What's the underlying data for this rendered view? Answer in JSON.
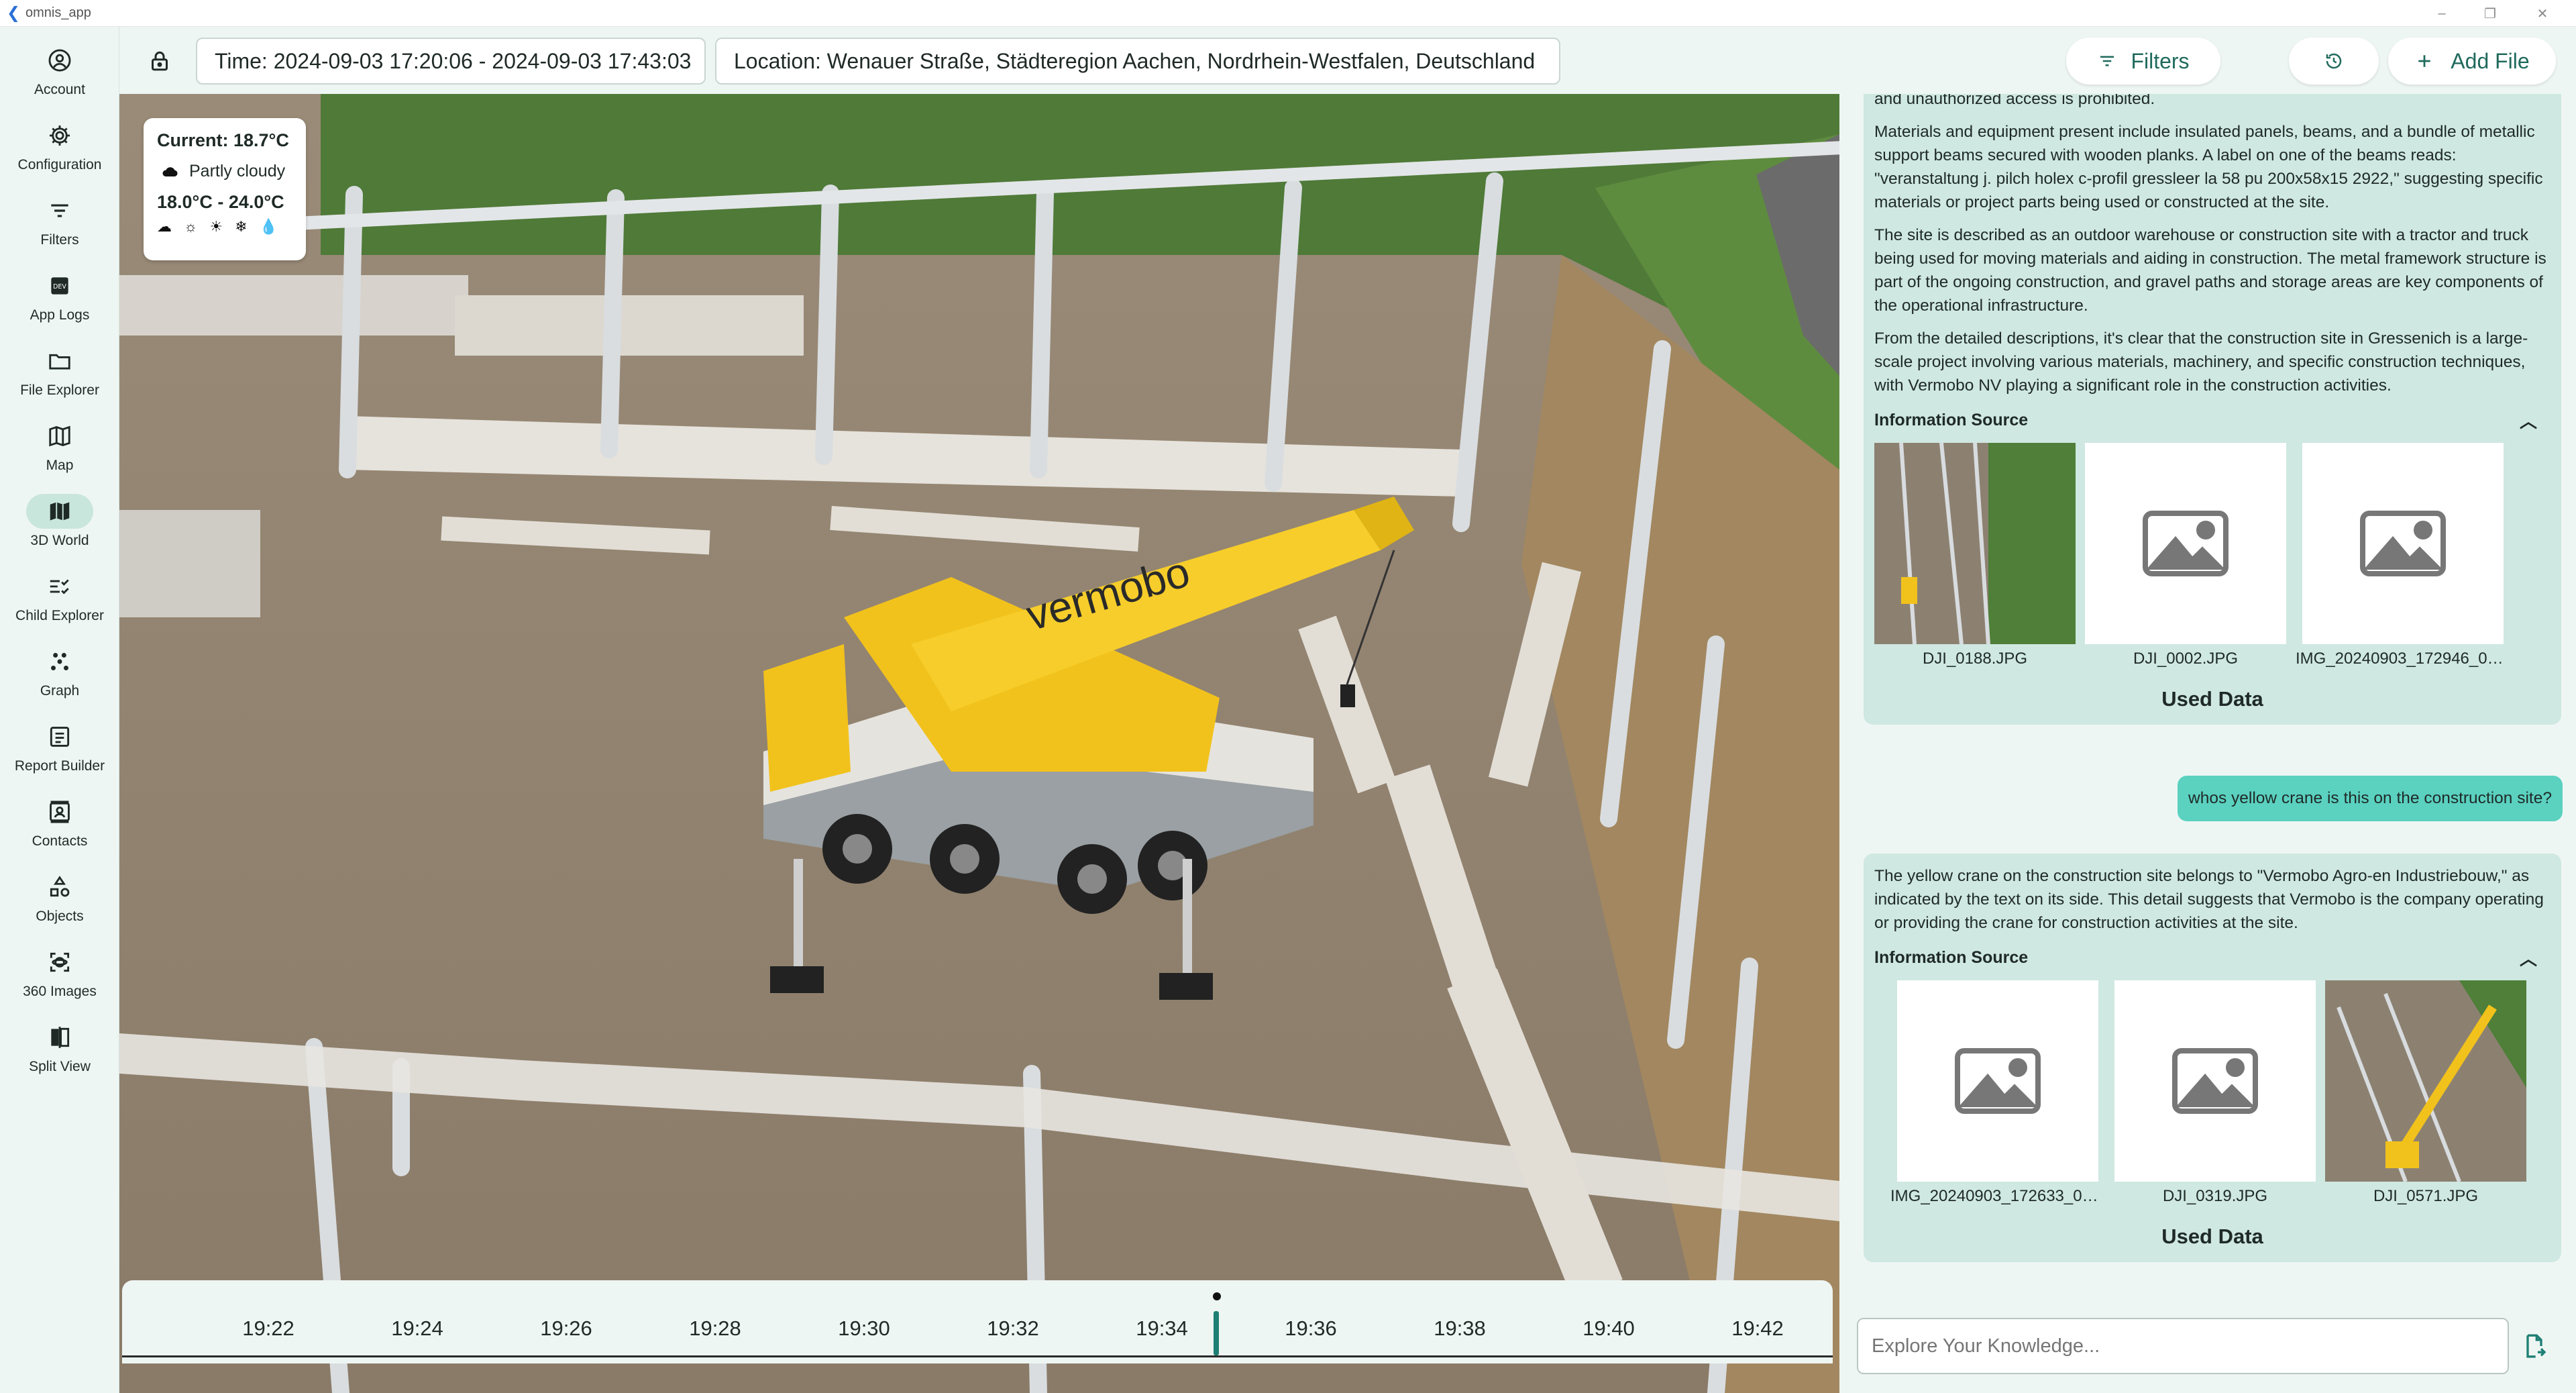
{
  "window": {
    "app_name": "omnis_app"
  },
  "sidebar": {
    "items": [
      {
        "label": "Account",
        "icon": "account-circle-icon"
      },
      {
        "label": "Configuration",
        "icon": "gear-icon"
      },
      {
        "label": "Filters",
        "icon": "filter-icon"
      },
      {
        "label": "App Logs",
        "icon": "dev-logs-icon"
      },
      {
        "label": "File Explorer",
        "icon": "folder-icon"
      },
      {
        "label": "Map",
        "icon": "map-icon"
      },
      {
        "label": "3D World",
        "icon": "3d-map-icon",
        "active": true
      },
      {
        "label": "Child Explorer",
        "icon": "checklist-icon"
      },
      {
        "label": "Graph",
        "icon": "graph-icon"
      },
      {
        "label": "Report Builder",
        "icon": "report-icon"
      },
      {
        "label": "Contacts",
        "icon": "contacts-icon"
      },
      {
        "label": "Objects",
        "icon": "objects-icon"
      },
      {
        "label": "360 Images",
        "icon": "360-icon"
      },
      {
        "label": "Split View",
        "icon": "split-view-icon"
      }
    ]
  },
  "toolbar": {
    "time_label": "Time: 2024-09-03 17:20:06 - 2024-09-03 17:43:03",
    "location_label": "Location: Wenauer Straße, Städteregion Aachen, Nordrhein-Westfalen, Deutschland",
    "filters_label": "Filters",
    "add_file_label": "Add File"
  },
  "weather": {
    "current": "Current: 18.7°C",
    "condition": "Partly cloudy",
    "range": "18.0°C - 24.0°C",
    "forecast_icons": "☁ ☼ ☀ ❄ 💧"
  },
  "timeline": {
    "ticks": [
      "19:22",
      "19:24",
      "19:26",
      "19:28",
      "19:30",
      "19:32",
      "19:34",
      "19:36",
      "19:38",
      "19:40",
      "19:42"
    ]
  },
  "chat": {
    "messages": [
      {
        "role": "assistant",
        "paragraphs": [
          "and unauthorized access is prohibited.",
          "Materials and equipment present include insulated panels, beams, and a bundle of metallic support beams secured with wooden planks. A label on one of the beams reads: \"veranstaltung j. pilch holex c-profil gressleer la 58 pu 200x58x15 2922,\" suggesting specific materials or project parts being used or constructed at the site.",
          "The site is described as an outdoor warehouse or construction site with a tractor and truck being used for moving materials and aiding in construction. The metal framework structure is part of the ongoing construction, and gravel paths and storage areas are key components of the operational infrastructure.",
          "From the detailed descriptions, it's clear that the construction site in Gressenich is a large-scale project involving various materials, machinery, and specific construction techniques, with Vermobo NV playing a significant role in the construction activities."
        ],
        "info_source_label": "Information Source",
        "sources": [
          "DJI_0188.JPG",
          "DJI_0002.JPG",
          "IMG_20240903_172946_00_0..."
        ],
        "used_data_label": "Used Data"
      },
      {
        "role": "user",
        "text": "whos yellow crane is this on the construction site?"
      },
      {
        "role": "assistant",
        "paragraphs": [
          "The yellow crane on the construction site belongs to \"Vermobo Agro-en Industriebouw,\" as indicated by the text on its side. This detail suggests that Vermobo is the company operating or providing the crane for construction activities at the site."
        ],
        "info_source_label": "Information Source",
        "sources": [
          "IMG_20240903_172633_00_0...",
          "DJI_0319.JPG",
          "DJI_0571.JPG"
        ],
        "used_data_label": "Used Data"
      }
    ],
    "input_placeholder": "Explore Your Knowledge..."
  },
  "scene": {
    "crane_brand_text": "vermobo"
  },
  "colors": {
    "accent": "#1e7f74",
    "sidebar_active": "#c9e6dd",
    "ai_bubble": "#cfe8e1",
    "user_bubble": "#5bd1c0",
    "background": "#eef6f3"
  }
}
